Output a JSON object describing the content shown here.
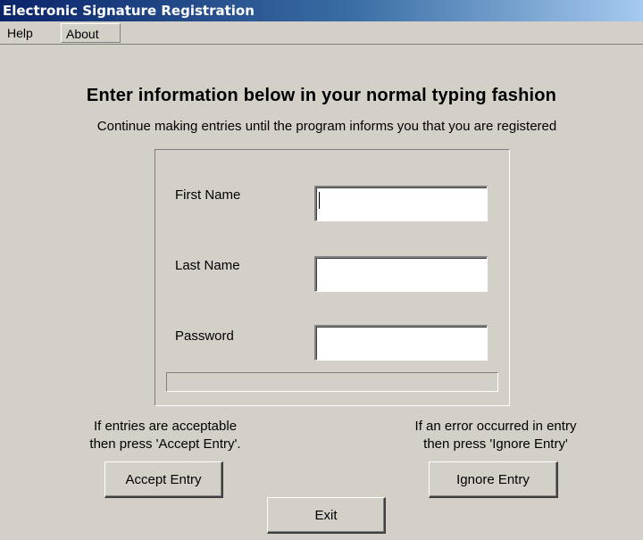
{
  "window": {
    "title": "Electronic Signature Registration"
  },
  "menu": {
    "items": [
      "Help",
      "About"
    ]
  },
  "heading": "Enter information below in your normal typing fashion",
  "subheading": "Continue making entries until the program informs you that you are registered",
  "form": {
    "first_name_label": "First Name",
    "first_name_value": "",
    "last_name_label": "Last Name",
    "last_name_value": "",
    "password_label": "Password",
    "password_value": "",
    "status_text": ""
  },
  "instructions": {
    "accept_line1": "If entries are acceptable",
    "accept_line2": "then press 'Accept Entry'.",
    "ignore_line1": "If an error occurred in entry",
    "ignore_line2": "then press 'Ignore Entry'"
  },
  "buttons": {
    "accept": "Accept Entry",
    "ignore": "Ignore Entry",
    "exit": "Exit"
  }
}
